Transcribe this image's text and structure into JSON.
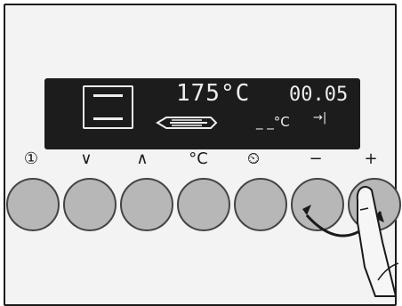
{
  "display": {
    "temperature": "175°C",
    "time": "00.05",
    "timer_arrow": "→|",
    "sub_temp_unit": "_ _°C"
  },
  "controls": [
    {
      "id": "power",
      "label": "①"
    },
    {
      "id": "down",
      "label": "∨"
    },
    {
      "id": "up",
      "label": "∧"
    },
    {
      "id": "temp",
      "label": "°C"
    },
    {
      "id": "timer",
      "label": "⏲"
    },
    {
      "id": "minus",
      "label": "−"
    },
    {
      "id": "plus",
      "label": "+"
    }
  ],
  "colors": {
    "display_bg": "#1c1c1c",
    "button_fill": "#b7b7b7",
    "display_text": "#eeeeee"
  }
}
